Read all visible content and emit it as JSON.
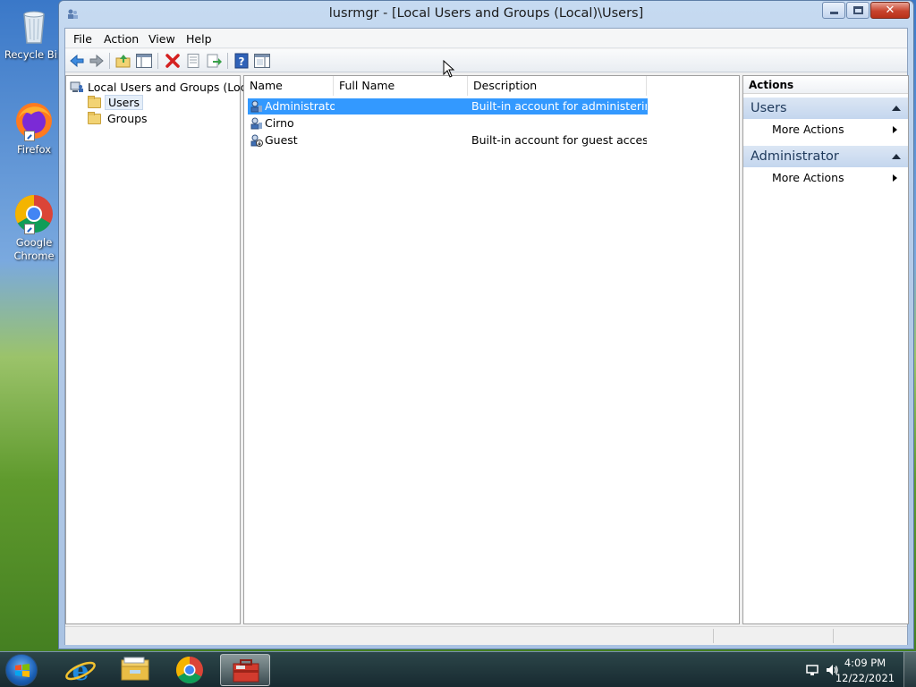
{
  "desktop": {
    "icons": [
      {
        "label": "Recycle Bin"
      },
      {
        "label": "Firefox"
      },
      {
        "label": "Google Chrome"
      }
    ]
  },
  "window": {
    "title": "lusrmgr - [Local Users and Groups (Local)\\Users]"
  },
  "menu": {
    "file": "File",
    "action": "Action",
    "view": "View",
    "help": "Help"
  },
  "toolbar": {
    "icons": [
      "back-arrow-icon",
      "forward-arrow-icon",
      "up-folder-icon",
      "show-hide-tree-icon",
      "delete-icon",
      "properties-icon",
      "export-list-icon",
      "help-icon",
      "show-hide-action-pane-icon"
    ]
  },
  "tree": {
    "root": "Local Users and Groups (Local)",
    "items": [
      {
        "label": "Users",
        "selected": true
      },
      {
        "label": "Groups",
        "selected": false
      }
    ]
  },
  "list": {
    "columns": [
      "Name",
      "Full Name",
      "Description"
    ],
    "rows": [
      {
        "name": "Administrator",
        "full_name": "",
        "description": "Built-in account for administering...",
        "selected": true
      },
      {
        "name": "Cirno",
        "full_name": "",
        "description": "",
        "selected": false
      },
      {
        "name": "Guest",
        "full_name": "",
        "description": "Built-in account for guest access t...",
        "selected": false
      }
    ]
  },
  "actions": {
    "header": "Actions",
    "sections": [
      {
        "title": "Users",
        "items": [
          "More Actions"
        ]
      },
      {
        "title": "Administrator",
        "items": [
          "More Actions"
        ]
      }
    ]
  },
  "taskbar": {
    "time": "4:09 PM",
    "date": "12/22/2021",
    "apps": [
      "internet-explorer-icon",
      "file-explorer-icon",
      "chrome-icon",
      "computer-management-icon"
    ]
  },
  "colors": {
    "selection": "#3399ff",
    "section_header": "#c4d6ee"
  }
}
